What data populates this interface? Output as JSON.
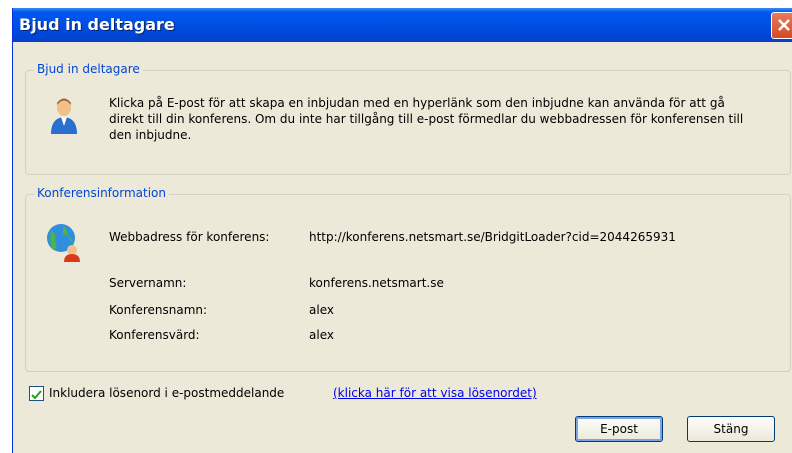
{
  "window": {
    "title": "Bjud in deltagare"
  },
  "invite_group": {
    "legend": "Bjud in deltagare",
    "instructions": "Klicka på E-post för att skapa en inbjudan med en hyperlänk som den inbjudne kan använda för att gå direkt till din konferens. Om du inte har tillgång till e-post förmedlar du webbadressen för konferensen till den inbjudne."
  },
  "conference_group": {
    "legend": "Konferensinformation",
    "web_address_label": "Webbadress för konferens:",
    "web_address_value": "http://konferens.netsmart.se/BridgitLoader?cid=2044265931",
    "server_label": "Servernamn:",
    "server_value": "konferens.netsmart.se",
    "conference_name_label": "Konferensnamn:",
    "conference_name_value": "alex",
    "host_label": "Konferensvärd:",
    "host_value": "alex"
  },
  "options": {
    "include_password_label": "Inkludera lösenord i e-postmeddelande",
    "include_password_checked": true,
    "show_password_link": "(klicka här för att visa lösenordet)"
  },
  "buttons": {
    "email": "E-post",
    "close": "Stäng"
  },
  "icons": {
    "user": "user-icon",
    "globe": "globe-user-icon",
    "check": "checkmark-icon",
    "close": "close-icon"
  }
}
